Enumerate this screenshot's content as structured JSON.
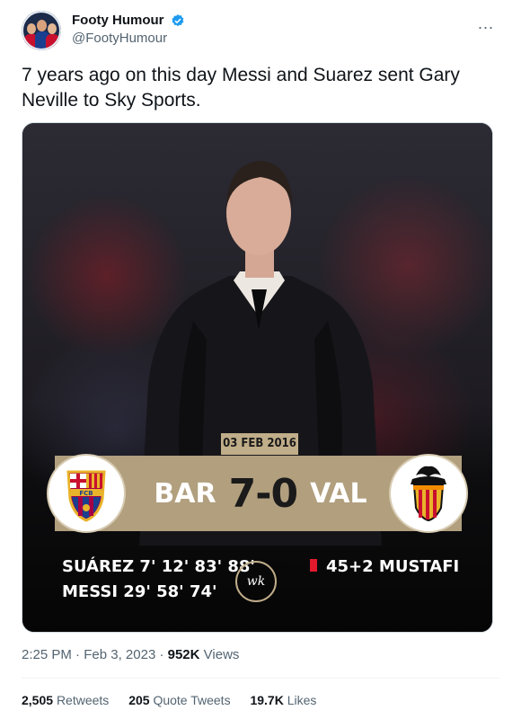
{
  "account": {
    "display_name": "Footy Humour",
    "handle": "@FootyHumour",
    "verified_color": "#1d9bf0",
    "more_icon": "..."
  },
  "tweet": {
    "text": "7 years ago on this day Messi and Suarez sent Gary Neville to Sky Sports."
  },
  "media": {
    "date": "03 FEB 2016",
    "home_team": "BAR",
    "away_team": "VAL",
    "score": "7-0",
    "home_crest_text": "FCB",
    "scorers": [
      "SUÁREZ 7' 12' 83' 88'",
      "MESSI 29' 58' 74'"
    ],
    "red_card": "45+2 MUSTAFI",
    "watermark": "wk",
    "accent_color": "#b19f7e",
    "red_card_color": "#e3192c"
  },
  "meta": {
    "time": "2:25 PM",
    "separator": "·",
    "date": "Feb 3, 2023",
    "views_count": "952K",
    "views_label": "Views"
  },
  "stats": {
    "retweets_count": "2,505",
    "retweets_label": "Retweets",
    "quotes_count": "205",
    "quotes_label": "Quote Tweets",
    "likes_count": "19.7K",
    "likes_label": "Likes"
  }
}
